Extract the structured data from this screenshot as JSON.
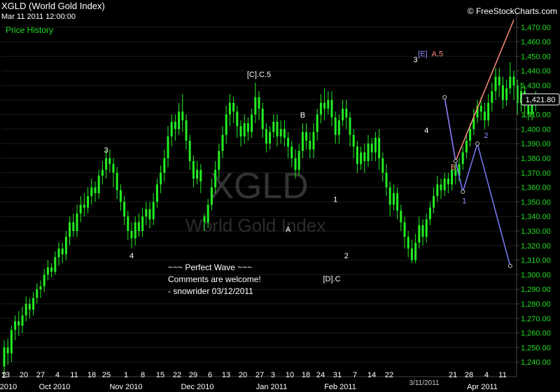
{
  "header": {
    "symbol_title": "XGLD (World Gold Index)",
    "timestamp": "Mar 11 2011 12:00:00",
    "panel_label": "Price History",
    "copyright": "© FreeStockCharts.com"
  },
  "watermark": {
    "symbol": "XGLD",
    "name": "World Gold Index"
  },
  "comment_lines": [
    "~~~ Perfect Wave ~~~",
    "Comments are welcome!",
    "- snowrider  03/12/2011"
  ],
  "last_price_label": "1,421.80",
  "date_marker": "3/11/2011",
  "colors": {
    "up": "#22ee22",
    "down": "#22ee22",
    "grid": "#1c1c1c",
    "axis_text": "#22dd22",
    "projection_salmon": "#ff8c80",
    "projection_blue": "#7b7bff"
  },
  "chart_data": {
    "type": "candlestick",
    "title": "XGLD (World Gold Index)",
    "ylim": [
      1230,
      1480
    ],
    "y_ticks": [
      "1,240.00",
      "1,250.00",
      "1,260.00",
      "1,270.00",
      "1,280.00",
      "1,290.00",
      "1,300.00",
      "1,310.00",
      "1,320.00",
      "1,330.00",
      "1,340.00",
      "1,350.00",
      "1,360.00",
      "1,370.00",
      "1,380.00",
      "1,390.00",
      "1,400.00",
      "1,410.00",
      "1,420.00",
      "1,430.00",
      "1,440.00",
      "1,450.00",
      "1,460.00",
      "1,470.00"
    ],
    "x_day_ticks": [
      "13",
      "20",
      "27",
      "4",
      "11",
      "18",
      "25",
      "1",
      "8",
      "15",
      "22",
      "29",
      "6",
      "13",
      "20",
      "27",
      "3",
      "10",
      "18",
      "24",
      "31",
      "7",
      "14",
      "22",
      "21",
      "28",
      "4",
      "11"
    ],
    "x_month_ticks": [
      "2010",
      "Oct 2010",
      "Nov 2010",
      "Dec 2010",
      "Jan 2011",
      "Feb 2011",
      "Apr 2011"
    ],
    "candles": [
      [
        1237,
        1250,
        1232,
        1255
      ],
      [
        1250,
        1246,
        1238,
        1256
      ],
      [
        1246,
        1262,
        1240,
        1265
      ],
      [
        1262,
        1268,
        1255,
        1272
      ],
      [
        1268,
        1265,
        1258,
        1275
      ],
      [
        1265,
        1272,
        1260,
        1278
      ],
      [
        1272,
        1280,
        1268,
        1285
      ],
      [
        1280,
        1276,
        1270,
        1284
      ],
      [
        1276,
        1284,
        1272,
        1288
      ],
      [
        1284,
        1290,
        1280,
        1294
      ],
      [
        1290,
        1292,
        1284,
        1296
      ],
      [
        1292,
        1300,
        1288,
        1304
      ],
      [
        1300,
        1305,
        1296,
        1310
      ],
      [
        1305,
        1302,
        1298,
        1308
      ],
      [
        1302,
        1312,
        1300,
        1316
      ],
      [
        1312,
        1318,
        1306,
        1322
      ],
      [
        1318,
        1314,
        1308,
        1322
      ],
      [
        1314,
        1326,
        1310,
        1330
      ],
      [
        1326,
        1336,
        1320,
        1340
      ],
      [
        1336,
        1330,
        1326,
        1342
      ],
      [
        1330,
        1342,
        1326,
        1348
      ],
      [
        1342,
        1348,
        1336,
        1354
      ],
      [
        1348,
        1346,
        1340,
        1356
      ],
      [
        1346,
        1354,
        1342,
        1360
      ],
      [
        1354,
        1360,
        1348,
        1366
      ],
      [
        1360,
        1356,
        1350,
        1364
      ],
      [
        1356,
        1368,
        1352,
        1372
      ],
      [
        1368,
        1372,
        1362,
        1378
      ],
      [
        1372,
        1380,
        1366,
        1386
      ],
      [
        1380,
        1376,
        1370,
        1386
      ],
      [
        1376,
        1370,
        1360,
        1380
      ],
      [
        1370,
        1358,
        1352,
        1374
      ],
      [
        1358,
        1350,
        1344,
        1362
      ],
      [
        1350,
        1340,
        1334,
        1354
      ],
      [
        1340,
        1330,
        1324,
        1344
      ],
      [
        1330,
        1325,
        1318,
        1336
      ],
      [
        1325,
        1336,
        1320,
        1340
      ],
      [
        1336,
        1330,
        1326,
        1342
      ],
      [
        1330,
        1340,
        1326,
        1346
      ],
      [
        1340,
        1345,
        1334,
        1350
      ],
      [
        1345,
        1338,
        1332,
        1350
      ],
      [
        1338,
        1350,
        1334,
        1356
      ],
      [
        1350,
        1362,
        1346,
        1366
      ],
      [
        1362,
        1370,
        1356,
        1375
      ],
      [
        1370,
        1380,
        1364,
        1386
      ],
      [
        1380,
        1395,
        1374,
        1402
      ],
      [
        1395,
        1405,
        1388,
        1410
      ],
      [
        1405,
        1400,
        1392,
        1410
      ],
      [
        1400,
        1412,
        1396,
        1418
      ],
      [
        1412,
        1406,
        1398,
        1424
      ],
      [
        1406,
        1392,
        1386,
        1410
      ],
      [
        1392,
        1378,
        1372,
        1396
      ],
      [
        1378,
        1366,
        1360,
        1382
      ],
      [
        1366,
        1372,
        1362,
        1378
      ],
      [
        1372,
        1364,
        1356,
        1376
      ],
      [
        1340,
        1336,
        1330,
        1342
      ],
      [
        1336,
        1348,
        1332,
        1352
      ],
      [
        1348,
        1360,
        1344,
        1366
      ],
      [
        1360,
        1372,
        1356,
        1378
      ],
      [
        1372,
        1385,
        1366,
        1390
      ],
      [
        1385,
        1396,
        1380,
        1402
      ],
      [
        1396,
        1410,
        1390,
        1416
      ],
      [
        1410,
        1418,
        1402,
        1424
      ],
      [
        1418,
        1412,
        1404,
        1422
      ],
      [
        1412,
        1402,
        1394,
        1416
      ],
      [
        1402,
        1395,
        1388,
        1406
      ],
      [
        1395,
        1404,
        1390,
        1410
      ],
      [
        1404,
        1398,
        1392,
        1408
      ],
      [
        1398,
        1410,
        1394,
        1414
      ],
      [
        1410,
        1422,
        1404,
        1432
      ],
      [
        1422,
        1414,
        1406,
        1426
      ],
      [
        1414,
        1400,
        1394,
        1418
      ],
      [
        1400,
        1390,
        1384,
        1404
      ],
      [
        1390,
        1398,
        1386,
        1402
      ],
      [
        1398,
        1405,
        1394,
        1410
      ],
      [
        1405,
        1395,
        1388,
        1410
      ],
      [
        1395,
        1400,
        1390,
        1406
      ],
      [
        1400,
        1394,
        1388,
        1406
      ],
      [
        1394,
        1388,
        1380,
        1398
      ],
      [
        1388,
        1380,
        1374,
        1392
      ],
      [
        1380,
        1372,
        1366,
        1386
      ],
      [
        1372,
        1385,
        1368,
        1390
      ],
      [
        1385,
        1398,
        1380,
        1404
      ],
      [
        1398,
        1392,
        1386,
        1404
      ],
      [
        1392,
        1386,
        1380,
        1398
      ],
      [
        1386,
        1398,
        1380,
        1404
      ],
      [
        1398,
        1410,
        1392,
        1414
      ],
      [
        1410,
        1418,
        1404,
        1424
      ],
      [
        1418,
        1414,
        1406,
        1428
      ],
      [
        1414,
        1420,
        1410,
        1426
      ],
      [
        1420,
        1408,
        1402,
        1426
      ],
      [
        1408,
        1396,
        1390,
        1412
      ],
      [
        1396,
        1406,
        1390,
        1410
      ],
      [
        1406,
        1414,
        1402,
        1420
      ],
      [
        1414,
        1408,
        1400,
        1420
      ],
      [
        1408,
        1396,
        1388,
        1412
      ],
      [
        1396,
        1388,
        1380,
        1400
      ],
      [
        1388,
        1376,
        1370,
        1392
      ],
      [
        1376,
        1384,
        1372,
        1388
      ],
      [
        1384,
        1378,
        1370,
        1390
      ],
      [
        1378,
        1390,
        1374,
        1396
      ],
      [
        1390,
        1384,
        1378,
        1394
      ],
      [
        1384,
        1394,
        1378,
        1398
      ],
      [
        1394,
        1380,
        1372,
        1400
      ],
      [
        1380,
        1370,
        1364,
        1384
      ],
      [
        1370,
        1360,
        1354,
        1376
      ],
      [
        1360,
        1348,
        1340,
        1364
      ],
      [
        1348,
        1356,
        1344,
        1362
      ],
      [
        1356,
        1344,
        1338,
        1360
      ],
      [
        1344,
        1336,
        1330,
        1348
      ],
      [
        1336,
        1326,
        1318,
        1340
      ],
      [
        1326,
        1318,
        1312,
        1330
      ],
      [
        1318,
        1310,
        1308,
        1324
      ],
      [
        1310,
        1322,
        1308,
        1328
      ],
      [
        1322,
        1334,
        1318,
        1340
      ],
      [
        1334,
        1326,
        1320,
        1338
      ],
      [
        1326,
        1338,
        1322,
        1342
      ],
      [
        1338,
        1346,
        1334,
        1350
      ],
      [
        1346,
        1354,
        1342,
        1360
      ],
      [
        1354,
        1362,
        1350,
        1368
      ],
      [
        1362,
        1358,
        1352,
        1366
      ],
      [
        1358,
        1366,
        1354,
        1370
      ],
      [
        1366,
        1362,
        1356,
        1370
      ],
      [
        1362,
        1372,
        1358,
        1376
      ],
      [
        1372,
        1368,
        1362,
        1376
      ],
      [
        1368,
        1376,
        1364,
        1380
      ],
      [
        1376,
        1384,
        1372,
        1388
      ],
      [
        1384,
        1392,
        1380,
        1396
      ],
      [
        1392,
        1400,
        1388,
        1404
      ],
      [
        1400,
        1408,
        1396,
        1414
      ],
      [
        1408,
        1416,
        1404,
        1420
      ],
      [
        1416,
        1412,
        1406,
        1422
      ],
      [
        1412,
        1406,
        1400,
        1418
      ],
      [
        1406,
        1418,
        1402,
        1424
      ],
      [
        1418,
        1426,
        1412,
        1432
      ],
      [
        1426,
        1436,
        1420,
        1442
      ],
      [
        1436,
        1430,
        1422,
        1442
      ],
      [
        1430,
        1420,
        1414,
        1436
      ],
      [
        1420,
        1428,
        1416,
        1434
      ],
      [
        1428,
        1436,
        1424,
        1446
      ],
      [
        1436,
        1430,
        1420,
        1440
      ],
      [
        1430,
        1418,
        1410,
        1434
      ],
      [
        1418,
        1426,
        1412,
        1432
      ],
      [
        1426,
        1416,
        1408,
        1430
      ],
      [
        1416,
        1410,
        1406,
        1420
      ],
      [
        1410,
        1418,
        1406,
        1424
      ],
      [
        1418,
        1421.8,
        1412,
        1426
      ]
    ],
    "wave_labels": [
      {
        "text": "2",
        "x_index": 0,
        "value": 1236,
        "color": "#ffffff",
        "pos": "below"
      },
      {
        "text": "3",
        "x_index": 28,
        "value": 1380,
        "color": "#ffffff",
        "pos": "above"
      },
      {
        "text": "4",
        "x_index": 35,
        "value": 1318,
        "color": "#ffffff",
        "pos": "below"
      },
      {
        "text": "[C].C.5",
        "x_index": 70,
        "value": 1432,
        "color": "#ffffff",
        "pos": "above"
      },
      {
        "text": "B",
        "x_index": 82,
        "value": 1404,
        "color": "#ffffff",
        "pos": "above"
      },
      {
        "text": "A",
        "x_index": 78,
        "value": 1336,
        "color": "#ffffff",
        "pos": "below"
      },
      {
        "text": "1",
        "x_index": 91,
        "value": 1346,
        "color": "#ffffff",
        "pos": "above"
      },
      {
        "text": "2",
        "x_index": 94,
        "value": 1318,
        "color": "#ffffff",
        "pos": "below"
      },
      {
        "text": "[D].C",
        "x_index": 90,
        "value": 1302,
        "color": "#ffffff",
        "pos": "below"
      },
      {
        "text": "3",
        "x_index": 113,
        "value": 1442,
        "color": "#ffffff",
        "pos": "above"
      },
      {
        "text": "4",
        "x_index": 116,
        "value": 1404,
        "color": "#ffffff",
        "pos": "below"
      },
      {
        "text": "[E]",
        "x_index": 115,
        "value": 1446,
        "color": "#8d8dff",
        "pos": "above"
      },
      {
        "text": "A.5",
        "x_index": 119,
        "value": 1446,
        "color": "#ff8c80",
        "pos": "above"
      }
    ],
    "projection_salmon": [
      {
        "x": 121,
        "y": 1421.8
      },
      {
        "x": 124,
        "y": 1378
      },
      {
        "x": 140,
        "y": 1475
      }
    ],
    "projection_blue": [
      {
        "x": 121,
        "y": 1421.8
      },
      {
        "x": 124,
        "y": 1378
      },
      {
        "x": 126,
        "y": 1357
      },
      {
        "x": 130,
        "y": 1390
      },
      {
        "x": 139,
        "y": 1306
      }
    ],
    "projection_labels": [
      {
        "text": "B",
        "x": 123,
        "y": 1372,
        "color": "#ff8c80"
      },
      {
        "text": "1",
        "x": 126,
        "y": 1349,
        "color": "#8d8dff"
      },
      {
        "text": "2",
        "x": 132,
        "y": 1394,
        "color": "#8d8dff"
      }
    ]
  }
}
